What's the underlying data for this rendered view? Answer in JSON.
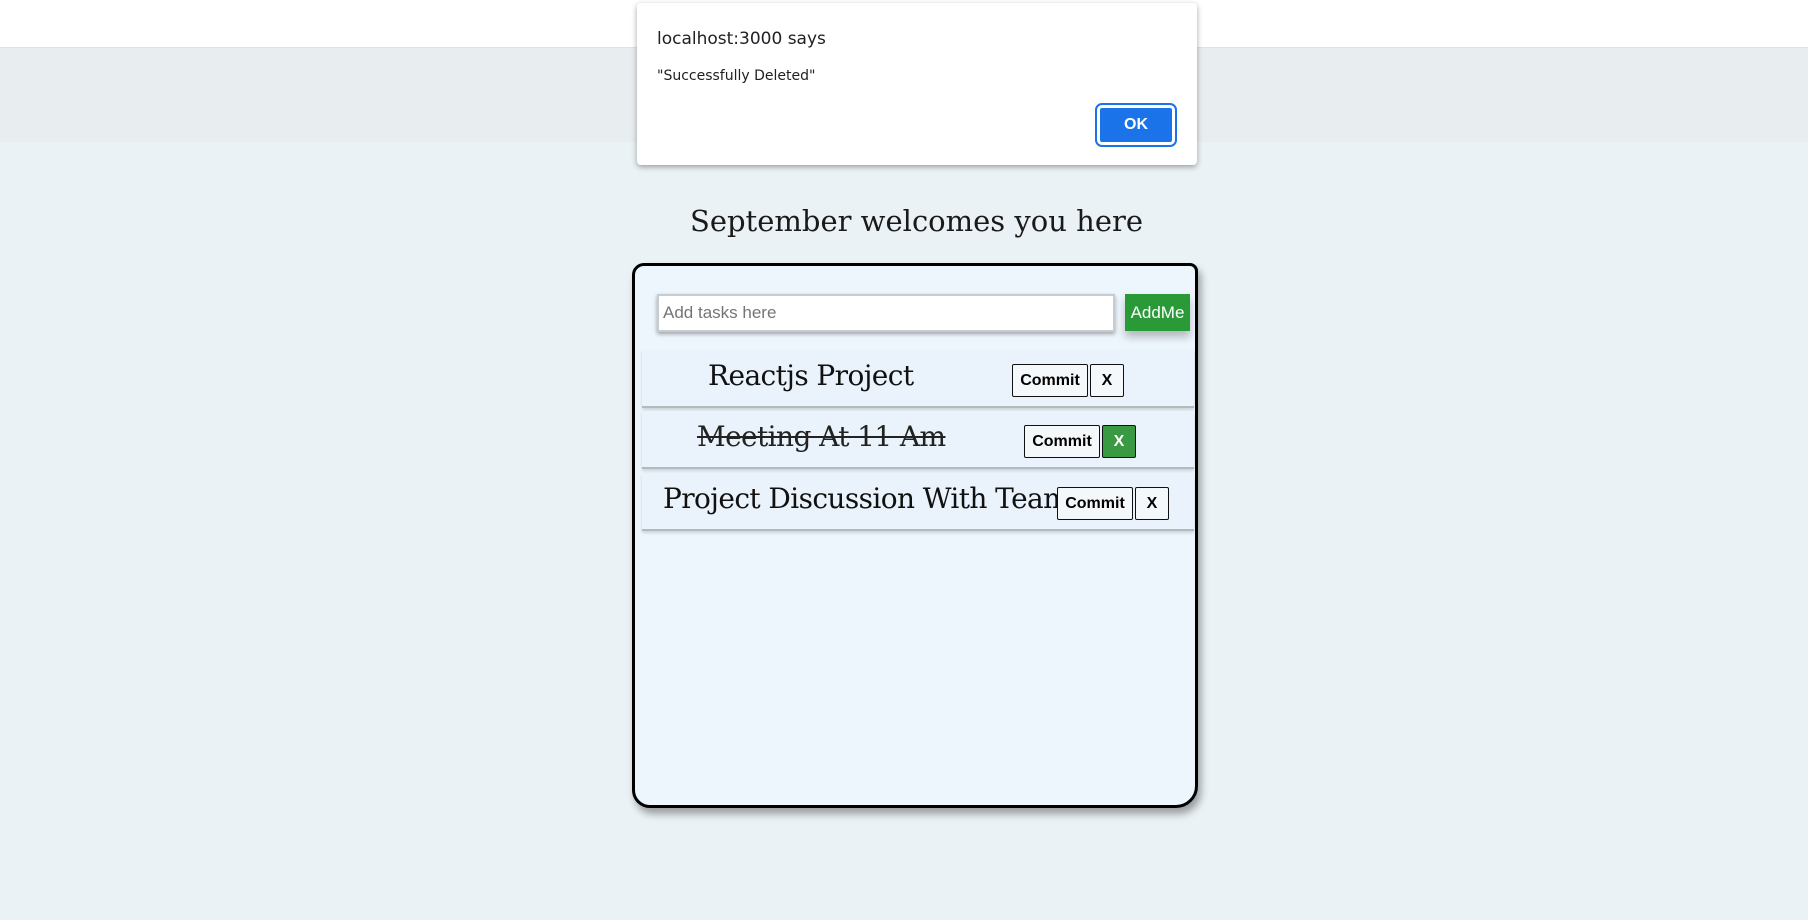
{
  "page": {
    "title": "September welcomes you here"
  },
  "input": {
    "placeholder": "Add tasks here",
    "value": ""
  },
  "add_button": {
    "label": "AddMe",
    "color": "#2a9a38"
  },
  "tasks": [
    {
      "text": "Reactjs Project",
      "completed": false,
      "commit_label": "Commit",
      "delete_label": "X"
    },
    {
      "text": "Meeting At 11 Am",
      "completed": true,
      "commit_label": "Commit",
      "delete_label": "X"
    },
    {
      "text": "Project Discussion With Team",
      "completed": false,
      "commit_label": "Commit",
      "delete_label": "X"
    }
  ],
  "dialog": {
    "title": "localhost:3000 says",
    "message": "\"Successfully Deleted\"",
    "ok_label": "OK",
    "ok_color": "#1a73e8"
  }
}
